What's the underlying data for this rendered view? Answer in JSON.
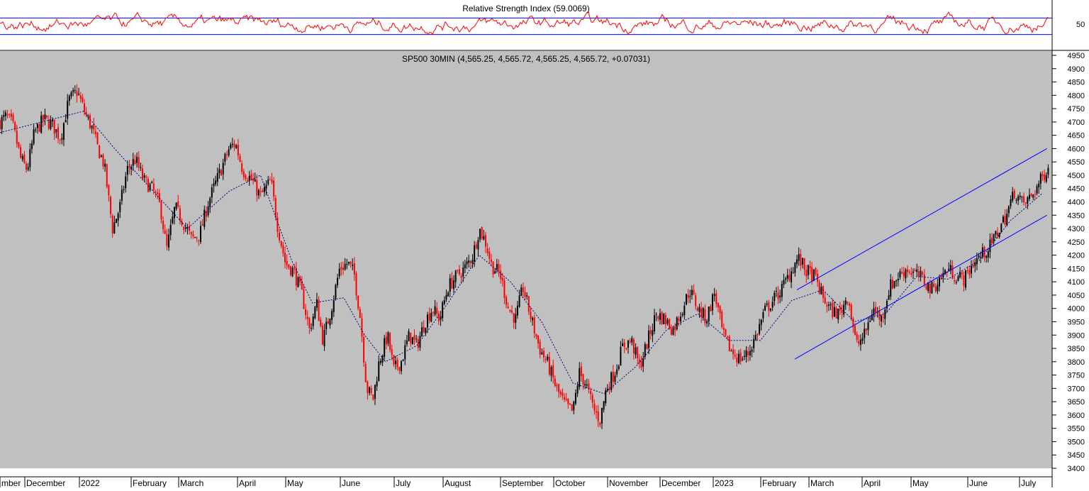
{
  "rsi_panel": {
    "title": "Relative Strength Index (59.0069)",
    "tick_label": "50",
    "overbought": 70,
    "oversold": 30,
    "line_color": "#ff0000",
    "band_color": "#0000ff"
  },
  "price_panel": {
    "title": "SP500 30MIN (4,565.25, 4,565.72, 4,565.25, 4,565.72, +0.07031)",
    "background": "#c0c0c0",
    "up_color": "#000000",
    "down_color": "#ff0000",
    "ma_color": "#000080",
    "channel_color": "#0000ff"
  },
  "chart_data": {
    "type": "candlestick",
    "y_range": [
      3400,
      4950
    ],
    "y_ticks": [
      3400,
      3450,
      3500,
      3550,
      3600,
      3650,
      3700,
      3750,
      3800,
      3850,
      3900,
      3950,
      4000,
      4050,
      4100,
      4150,
      4200,
      4250,
      4300,
      4350,
      4400,
      4450,
      4500,
      4550,
      4600,
      4650,
      4700,
      4750,
      4800,
      4850,
      4900,
      4950
    ],
    "x_labels": [
      "mber",
      "December",
      "2022",
      "February",
      "March",
      "April",
      "May",
      "June",
      "July",
      "August",
      "September",
      "October",
      "November",
      "December",
      "2023",
      "February",
      "March",
      "April",
      "May",
      "June",
      "July"
    ],
    "price_path": [
      [
        0,
        4700
      ],
      [
        0.6,
        4720
      ],
      [
        1.2,
        4690
      ],
      [
        2.0,
        4560
      ],
      [
        2.6,
        4520
      ],
      [
        3.3,
        4660
      ],
      [
        4.2,
        4710
      ],
      [
        5.0,
        4690
      ],
      [
        5.8,
        4640
      ],
      [
        6.6,
        4780
      ],
      [
        7.4,
        4815
      ],
      [
        8.2,
        4730
      ],
      [
        8.8,
        4680
      ],
      [
        9.4,
        4600
      ],
      [
        10.0,
        4540
      ],
      [
        10.8,
        4300
      ],
      [
        11.5,
        4380
      ],
      [
        12.2,
        4520
      ],
      [
        13.0,
        4560
      ],
      [
        13.8,
        4480
      ],
      [
        14.6,
        4450
      ],
      [
        15.4,
        4380
      ],
      [
        16.0,
        4220
      ],
      [
        16.8,
        4380
      ],
      [
        17.5,
        4330
      ],
      [
        18.4,
        4260
      ],
      [
        19.2,
        4280
      ],
      [
        20.0,
        4400
      ],
      [
        21.0,
        4500
      ],
      [
        22.0,
        4600
      ],
      [
        22.6,
        4620
      ],
      [
        23.3,
        4520
      ],
      [
        24.2,
        4480
      ],
      [
        25.0,
        4420
      ],
      [
        26.0,
        4480
      ],
      [
        26.6,
        4320
      ],
      [
        27.4,
        4170
      ],
      [
        28.2,
        4140
      ],
      [
        29.0,
        4050
      ],
      [
        29.7,
        3920
      ],
      [
        30.4,
        4020
      ],
      [
        31.0,
        3880
      ],
      [
        31.8,
        4000
      ],
      [
        32.6,
        4150
      ],
      [
        33.4,
        4170
      ],
      [
        34.0,
        4130
      ],
      [
        34.6,
        3960
      ],
      [
        35.2,
        3700
      ],
      [
        35.8,
        3660
      ],
      [
        36.4,
        3800
      ],
      [
        37.2,
        3900
      ],
      [
        37.8,
        3770
      ],
      [
        38.5,
        3800
      ],
      [
        39.3,
        3900
      ],
      [
        40.0,
        3860
      ],
      [
        40.8,
        3950
      ],
      [
        41.5,
        4000
      ],
      [
        42.2,
        3960
      ],
      [
        43.0,
        4080
      ],
      [
        43.8,
        4120
      ],
      [
        44.6,
        4150
      ],
      [
        45.4,
        4200
      ],
      [
        46.0,
        4300
      ],
      [
        46.6,
        4250
      ],
      [
        47.2,
        4160
      ],
      [
        48.0,
        4130
      ],
      [
        48.8,
        4000
      ],
      [
        49.5,
        3960
      ],
      [
        50.2,
        4080
      ],
      [
        51.0,
        3960
      ],
      [
        51.8,
        3850
      ],
      [
        52.6,
        3790
      ],
      [
        53.4,
        3700
      ],
      [
        54.2,
        3640
      ],
      [
        55.0,
        3610
      ],
      [
        55.6,
        3760
      ],
      [
        56.2,
        3720
      ],
      [
        57.0,
        3620
      ],
      [
        57.6,
        3580
      ],
      [
        58.2,
        3700
      ],
      [
        59.0,
        3760
      ],
      [
        59.8,
        3860
      ],
      [
        60.6,
        3880
      ],
      [
        61.4,
        3780
      ],
      [
        62.2,
        3880
      ],
      [
        63.0,
        3980
      ],
      [
        63.8,
        3960
      ],
      [
        64.6,
        3920
      ],
      [
        65.4,
        3990
      ],
      [
        66.2,
        4070
      ],
      [
        67.0,
        4000
      ],
      [
        67.8,
        3960
      ],
      [
        68.6,
        4060
      ],
      [
        69.4,
        3900
      ],
      [
        70.2,
        3840
      ],
      [
        71.0,
        3810
      ],
      [
        71.8,
        3830
      ],
      [
        72.6,
        3900
      ],
      [
        73.4,
        3990
      ],
      [
        74.2,
        4030
      ],
      [
        75.0,
        4070
      ],
      [
        75.8,
        4130
      ],
      [
        76.6,
        4190
      ],
      [
        77.4,
        4140
      ],
      [
        78.2,
        4120
      ],
      [
        79.0,
        4040
      ],
      [
        79.8,
        3990
      ],
      [
        80.6,
        3980
      ],
      [
        81.4,
        4050
      ],
      [
        82.2,
        3860
      ],
      [
        83.0,
        3900
      ],
      [
        83.8,
        4000
      ],
      [
        84.6,
        3960
      ],
      [
        85.4,
        4080
      ],
      [
        86.2,
        4120
      ],
      [
        87.0,
        4150
      ],
      [
        87.8,
        4130
      ],
      [
        88.6,
        4110
      ],
      [
        89.4,
        4070
      ],
      [
        90.2,
        4110
      ],
      [
        91.0,
        4150
      ],
      [
        91.8,
        4120
      ],
      [
        92.6,
        4110
      ],
      [
        93.4,
        4170
      ],
      [
        94.2,
        4200
      ],
      [
        95.0,
        4230
      ],
      [
        95.8,
        4290
      ],
      [
        96.6,
        4350
      ],
      [
        97.4,
        4440
      ],
      [
        98.2,
        4390
      ],
      [
        99.0,
        4420
      ],
      [
        99.6,
        4460
      ],
      [
        100.2,
        4500
      ],
      [
        100.8,
        4560
      ]
    ],
    "moving_average": [
      [
        0,
        4660
      ],
      [
        4,
        4700
      ],
      [
        8,
        4740
      ],
      [
        11,
        4600
      ],
      [
        14,
        4470
      ],
      [
        18,
        4300
      ],
      [
        22,
        4440
      ],
      [
        25,
        4500
      ],
      [
        28,
        4180
      ],
      [
        30,
        4020
      ],
      [
        33,
        4040
      ],
      [
        35,
        3900
      ],
      [
        37,
        3800
      ],
      [
        40,
        3860
      ],
      [
        43,
        4020
      ],
      [
        46,
        4200
      ],
      [
        49,
        4100
      ],
      [
        52,
        3950
      ],
      [
        55,
        3720
      ],
      [
        58,
        3680
      ],
      [
        61,
        3780
      ],
      [
        64,
        3920
      ],
      [
        67,
        3980
      ],
      [
        70,
        3880
      ],
      [
        73,
        3880
      ],
      [
        76,
        4030
      ],
      [
        79,
        4070
      ],
      [
        82,
        3950
      ],
      [
        85,
        3980
      ],
      [
        88,
        4120
      ],
      [
        91,
        4110
      ],
      [
        94,
        4180
      ],
      [
        97,
        4330
      ],
      [
        100,
        4430
      ]
    ],
    "channel": {
      "upper": [
        [
          76.5,
          4070
        ],
        [
          100.5,
          4600
        ]
      ],
      "lower": [
        [
          76.3,
          3810
        ],
        [
          100.5,
          4350
        ]
      ]
    },
    "rsi_range": [
      0,
      100
    ]
  }
}
